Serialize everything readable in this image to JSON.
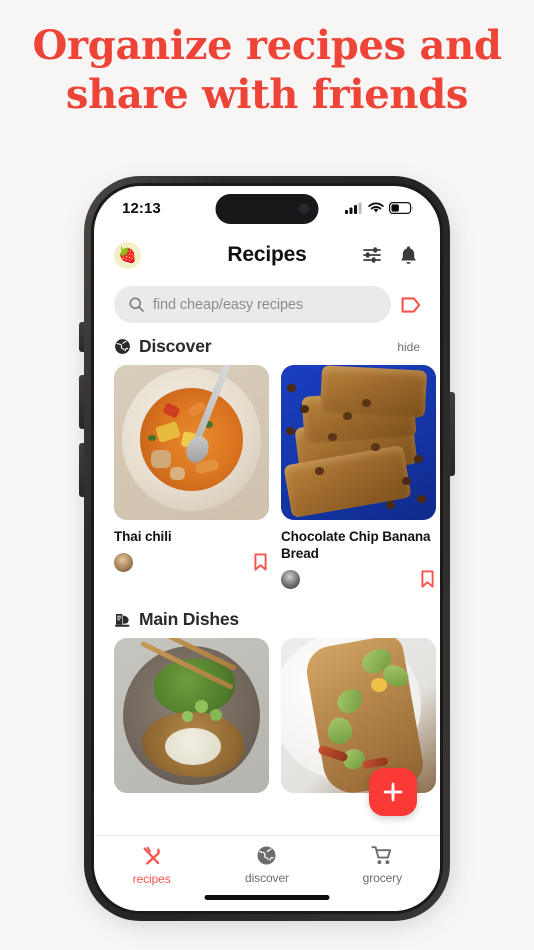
{
  "promo": {
    "headline_line1": "Organize recipes and",
    "headline_line2": "share with friends",
    "headline_color": "#ee4337"
  },
  "status_bar": {
    "time": "12:13",
    "signal_icon": "cellular-signal-icon",
    "wifi_icon": "wifi-icon",
    "battery_icon": "battery-icon"
  },
  "header": {
    "avatar_emoji": "🍓",
    "title": "Recipes",
    "filter_icon": "filter-sliders-icon",
    "notifications_icon": "bell-icon"
  },
  "search": {
    "placeholder": "find cheap/easy recipes",
    "icon": "search-icon",
    "tag_icon": "tag-icon",
    "tag_color": "#f6534c"
  },
  "sections": [
    {
      "id": "discover",
      "icon": "globe-icon",
      "title": "Discover",
      "action_label": "hide",
      "cards": [
        {
          "title": "Thai chili",
          "art": "soup",
          "avatar": "av-soup",
          "bookmark_icon": "bookmark-icon"
        },
        {
          "title": "Chocolate Chip Banana Bread",
          "art": "bread",
          "avatar": "av-dark",
          "bookmark_icon": "bookmark-icon"
        }
      ]
    },
    {
      "id": "main-dishes",
      "icon": "recipe-book-icon",
      "title": "Main Dishes",
      "action_label": "",
      "cards": [
        {
          "title": "",
          "art": "bowl",
          "avatar": "",
          "bookmark_icon": ""
        },
        {
          "title": "",
          "art": "sandwich",
          "avatar": "",
          "bookmark_icon": ""
        }
      ]
    }
  ],
  "fab": {
    "label": "+",
    "icon": "plus-icon",
    "color": "#fa3a37"
  },
  "tabbar": {
    "active_color": "#f6534c",
    "items": [
      {
        "label": "recipes",
        "icon": "fork-spoon-icon",
        "active": true
      },
      {
        "label": "discover",
        "icon": "globe-icon",
        "active": false
      },
      {
        "label": "grocery",
        "icon": "shopping-cart-icon",
        "active": false
      }
    ]
  }
}
